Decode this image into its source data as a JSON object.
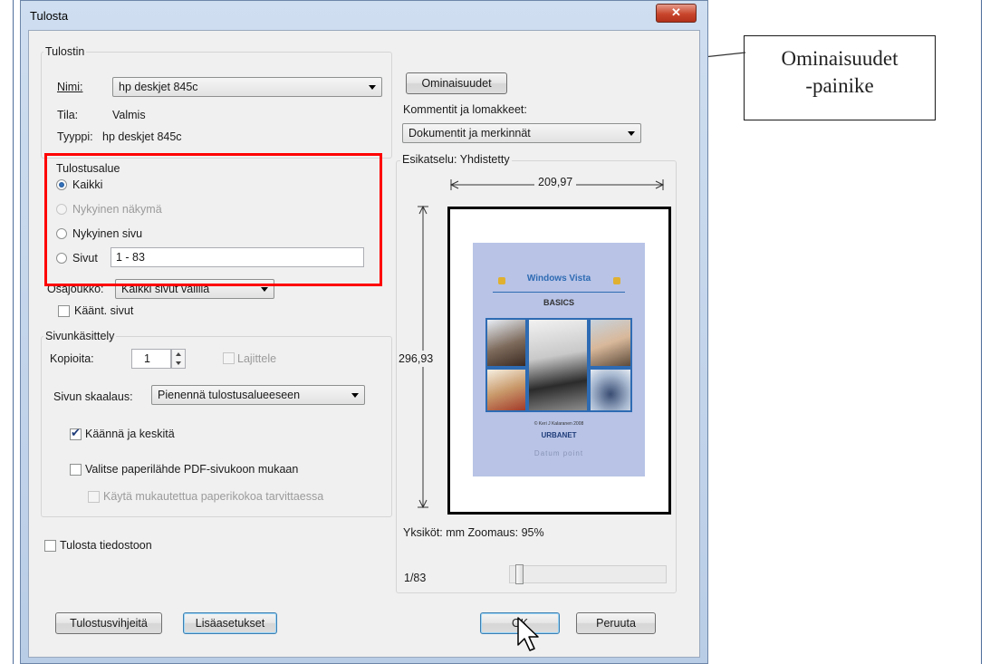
{
  "dialog": {
    "title": "Tulosta",
    "close_glyph": "✕",
    "printer": {
      "group_label": "Tulostin",
      "name_label": "Nimi:",
      "name_value": "hp deskjet 845c",
      "status_label": "Tila:",
      "status_value": "Valmis",
      "type_label": "Tyyppi:",
      "type_value": "hp deskjet 845c"
    },
    "properties_button": "Ominaisuudet",
    "comments": {
      "label": "Kommentit ja lomakkeet:",
      "value": "Dokumentit ja merkinnät"
    },
    "print_range": {
      "label": "Tulostusalue",
      "all": "Kaikki",
      "current_view": "Nykyinen näkymä",
      "current_page": "Nykyinen sivu",
      "pages": "Sivut",
      "pages_value": "1 - 83",
      "subset_label": "Osajoukko:",
      "subset_value": "Kaikki sivut välillä",
      "reverse": "Käänt. sivut"
    },
    "page_handling": {
      "label": "Sivunkäsittely",
      "copies_label": "Kopioita:",
      "copies_value": "1",
      "collate": "Lajittele",
      "scaling_label": "Sivun skaalaus:",
      "scaling_value": "Pienennä tulostusalueeseen",
      "autorotate": "Käännä ja keskitä",
      "paper_source": "Valitse paperilähde PDF-sivukoon mukaan",
      "custom_paper": "Käytä mukautettua paperikokoa tarvittaessa"
    },
    "print_to_file": "Tulosta tiedostoon",
    "preview": {
      "label": "Esikatselu: Yhdistetty",
      "width": "209,97",
      "height": "296,93",
      "units": "Yksiköt: mm Zoomaus:  95%",
      "page_counter": "1/83",
      "cover": {
        "title": "Windows Vista",
        "subtitle": "BASICS",
        "copyright": "© Keri J Kalaranen 2008",
        "brand": "URBANET",
        "footer": "Datum point"
      }
    },
    "buttons": {
      "tips": "Tulostusvihjeitä",
      "advanced": "Lisäasetukset",
      "ok": "OK",
      "cancel": "Peruuta"
    }
  },
  "callout": {
    "line1": "Ominaisuudet",
    "line2": "-painike"
  },
  "colors": {
    "highlight": "#ff0000",
    "accent": "#2e6bb3"
  }
}
